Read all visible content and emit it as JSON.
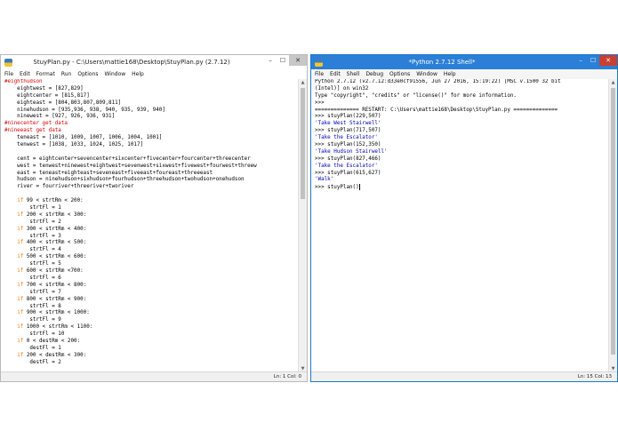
{
  "left_window": {
    "title": "StuyPlan.py - C:\\Users\\mattie168\\Desktop\\StuyPlan.py (2.7.12)",
    "menu": [
      "File",
      "Edit",
      "Format",
      "Run",
      "Options",
      "Window",
      "Help"
    ],
    "controls": {
      "minimize": "–",
      "maximize": "☐",
      "close": "✕"
    },
    "code_lines": [
      {
        "text": "#eighthudson",
        "kind": "comment"
      },
      {
        "text": "    eightwest = [827,829]",
        "kind": "code"
      },
      {
        "text": "    eightcenter = [815,817]",
        "kind": "code"
      },
      {
        "text": "    eighteast = [804,803,807,809,811]",
        "kind": "code"
      },
      {
        "text": "    ninehudson = [935,936, 938, 940, 935, 939, 940]",
        "kind": "code"
      },
      {
        "text": "    ninewest = [927, 926, 936, 931]",
        "kind": "code"
      },
      {
        "text": "#ninecenter get data",
        "kind": "comment"
      },
      {
        "text": "#nineeast get data",
        "kind": "comment"
      },
      {
        "text": "    teneast = [1010, 1009, 1007, 1006, 1004, 1001]",
        "kind": "code"
      },
      {
        "text": "    tenwest = [1038, 1033, 1024, 1025, 1017]",
        "kind": "code"
      },
      {
        "text": "",
        "kind": "code"
      },
      {
        "text": "    cent = eightcenter+sevencenter+sixcenter+fivecenter+fourcenter+threecenter",
        "kind": "code"
      },
      {
        "text": "    west = tenwest+ninewest+eightwest+sevenwest+sixwest+fivewest+fourwest+threew",
        "kind": "code"
      },
      {
        "text": "    east = teneast+eighteast+seveneast+fiveeast+foureast+threeeast",
        "kind": "code"
      },
      {
        "text": "    hudson = ninehudson+sixhudson+fourhudson+threehudson+twohudson+onehudson",
        "kind": "code"
      },
      {
        "text": "    river = fourriver+threeriver+tworiver",
        "kind": "code"
      },
      {
        "text": "",
        "kind": "code"
      },
      {
        "text": "    if 99 < strtRm < 200:",
        "kind": "if"
      },
      {
        "text": "        strtFl = 1",
        "kind": "code"
      },
      {
        "text": "    if 200 < strtRm < 300:",
        "kind": "if"
      },
      {
        "text": "        strtFl = 2",
        "kind": "code"
      },
      {
        "text": "    if 300 < strtRm < 400:",
        "kind": "if"
      },
      {
        "text": "        strtFl = 3",
        "kind": "code"
      },
      {
        "text": "    if 400 < strtRm < 500:",
        "kind": "if"
      },
      {
        "text": "        strtFl = 4",
        "kind": "code"
      },
      {
        "text": "    if 500 < strtRm < 600:",
        "kind": "if"
      },
      {
        "text": "        strtFl = 5",
        "kind": "code"
      },
      {
        "text": "    if 600 < strtRm <700:",
        "kind": "if"
      },
      {
        "text": "        strtFl = 6",
        "kind": "code"
      },
      {
        "text": "    if 700 < strtRm < 800:",
        "kind": "if"
      },
      {
        "text": "        strtFl = 7",
        "kind": "code"
      },
      {
        "text": "    if 800 < strtRm < 900:",
        "kind": "if"
      },
      {
        "text": "        strtFl = 8",
        "kind": "code"
      },
      {
        "text": "    if 900 < strtRm < 1000:",
        "kind": "if"
      },
      {
        "text": "        strtFl = 9",
        "kind": "code"
      },
      {
        "text": "    if 1000 < strtRm < 1100:",
        "kind": "if"
      },
      {
        "text": "        strtFl = 10",
        "kind": "code"
      },
      {
        "text": "    if 0 < destRm < 200:",
        "kind": "if"
      },
      {
        "text": "        destFl = 1",
        "kind": "code"
      },
      {
        "text": "    if 200 < destRm < 300:",
        "kind": "if"
      },
      {
        "text": "        destFl = 2",
        "kind": "code"
      }
    ],
    "status": "Ln: 1   Col: 0"
  },
  "right_window": {
    "title": "*Python 2.7.12 Shell*",
    "menu": [
      "File",
      "Edit",
      "Shell",
      "Debug",
      "Options",
      "Window",
      "Help"
    ],
    "controls": {
      "minimize": "–",
      "maximize": "☐",
      "close": "✕"
    },
    "shell_lines": [
      {
        "text": "Python 2.7.12 (v2.7.12:d33e0cf91556, Jun 27 2016, 15:19:22) [MSC v.1500 32 bit",
        "kind": "plain"
      },
      {
        "text": "(Intel)] on win32",
        "kind": "plain"
      },
      {
        "text": "Type \"copyright\", \"credits\" or \"license()\" for more information.",
        "kind": "plain"
      },
      {
        "text": ">>> ",
        "kind": "prompt"
      },
      {
        "text": "============== RESTART: C:\\Users\\mattie168\\Desktop\\StuyPlan.py ==============",
        "kind": "plain"
      },
      {
        "text": ">>> stuyPlan(229,507)",
        "kind": "prompt"
      },
      {
        "text": "'Take West Stairwell'",
        "kind": "output"
      },
      {
        "text": ">>> stuyPlan(717,507)",
        "kind": "prompt"
      },
      {
        "text": "'Take the Escalator'",
        "kind": "output"
      },
      {
        "text": ">>> stuyPlan(152,350)",
        "kind": "prompt"
      },
      {
        "text": "'Take Hudson Stairwell'",
        "kind": "output"
      },
      {
        "text": ">>> stuyPlan(827,466)",
        "kind": "prompt"
      },
      {
        "text": "'Take the Escalator'",
        "kind": "output"
      },
      {
        "text": ">>> stuyPlan(615,627)",
        "kind": "prompt"
      },
      {
        "text": "'Walk'",
        "kind": "output"
      },
      {
        "text": ">>> stuyPlan()",
        "kind": "prompt-cursor"
      }
    ],
    "status": "Ln: 15   Col: 13"
  }
}
